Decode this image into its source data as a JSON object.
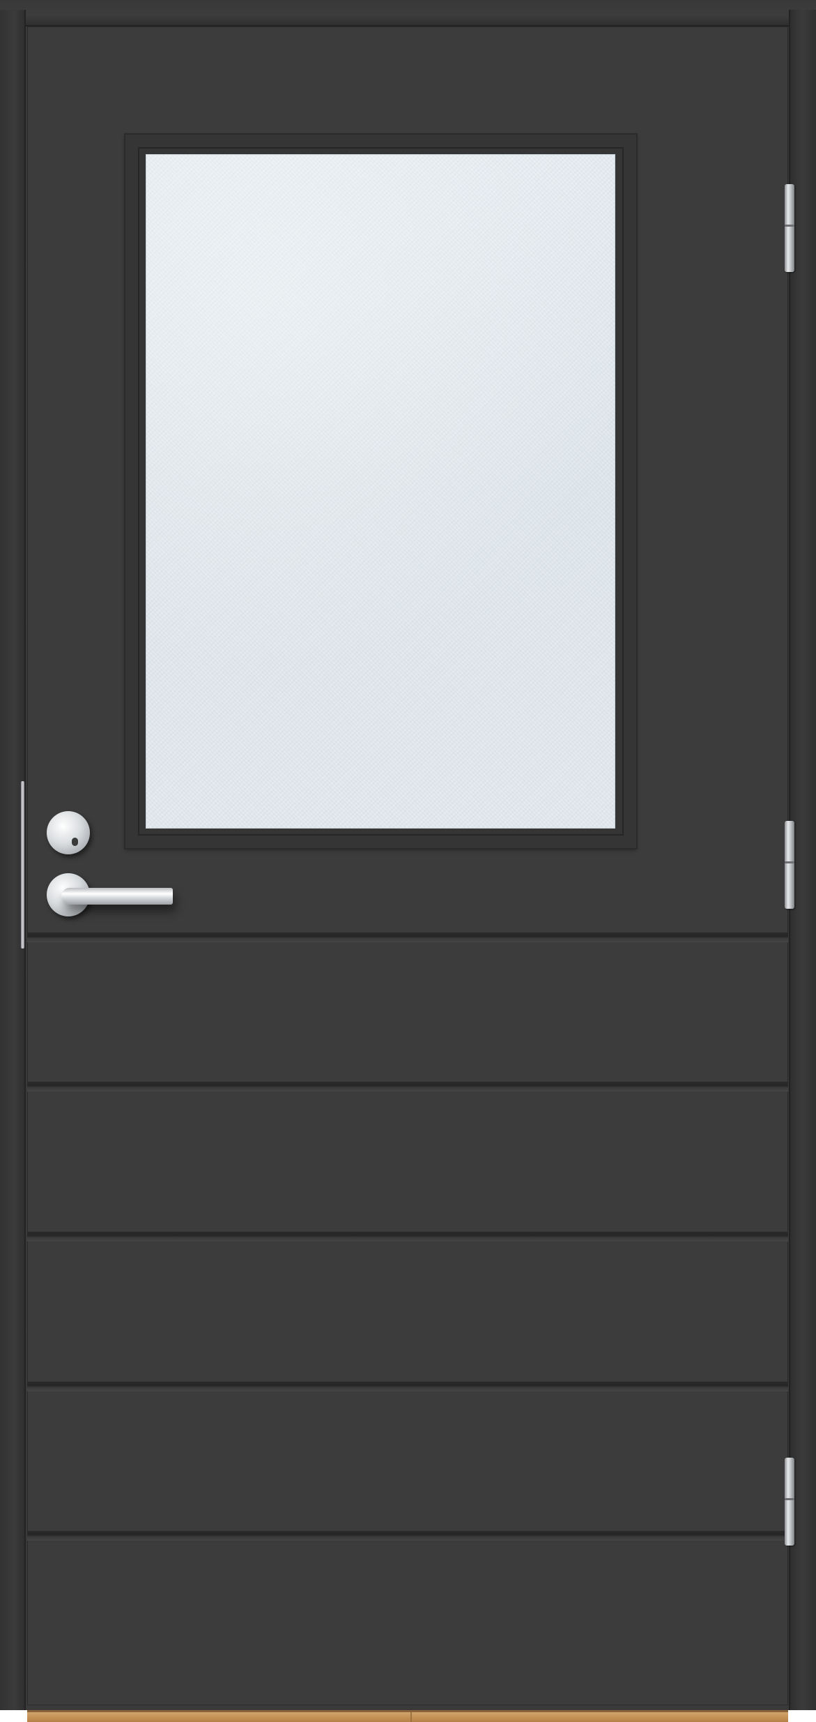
{
  "scene": {
    "subject": "door",
    "door_color": "#3c3c3c",
    "frame_color": "#3a3a3a",
    "glass_color": "#e3e9ed",
    "hardware_color": "#d6d9dc",
    "threshold_color": "#c8965b",
    "panel_count": 5,
    "hinge_count": 3
  }
}
